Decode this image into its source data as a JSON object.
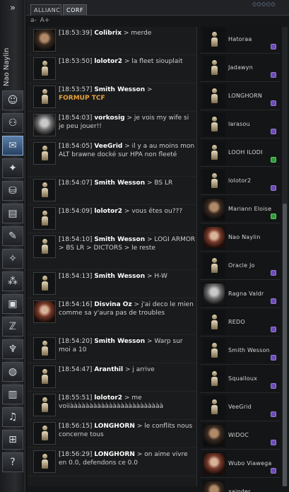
{
  "neocom": {
    "pilot_name": "Nao Naylin",
    "buttons": [
      {
        "icon": "character-icon",
        "glyph": "☺"
      },
      {
        "icon": "people-icon",
        "glyph": "⚇"
      },
      {
        "icon": "mail-icon",
        "glyph": "✉"
      },
      {
        "icon": "map-icon",
        "glyph": "✦"
      },
      {
        "icon": "market-icon",
        "glyph": "⛁"
      },
      {
        "icon": "journal-icon",
        "glyph": "▤"
      },
      {
        "icon": "notepad-icon",
        "glyph": "✎"
      },
      {
        "icon": "starmap-icon",
        "glyph": "✧"
      },
      {
        "icon": "fleet-icon",
        "glyph": "⁂"
      },
      {
        "icon": "cargo-icon",
        "glyph": "▣"
      },
      {
        "icon": "skills-icon",
        "glyph": "ℤ"
      },
      {
        "icon": "corporation-icon",
        "glyph": "♆"
      },
      {
        "icon": "alliance-icon",
        "glyph": "◍"
      },
      {
        "icon": "log-icon",
        "glyph": "▥"
      },
      {
        "icon": "music-icon",
        "glyph": "♫"
      },
      {
        "icon": "calculator-icon",
        "glyph": "⊞"
      },
      {
        "icon": "help-icon",
        "glyph": "?"
      }
    ]
  },
  "tabs": [
    {
      "label": "ALLIANC",
      "active": false
    },
    {
      "label": "CORF",
      "active": true
    }
  ],
  "toolbar": {
    "font_small": "a-",
    "font_large": "A+"
  },
  "messages": [
    {
      "time": "[18:53:39]",
      "author": "Colibrix",
      "text": "merde",
      "portrait": "photo-dark"
    },
    {
      "time": "[18:53:50]",
      "author": "lolotor2",
      "text": "la fleet siouplait",
      "portrait": "silhouette"
    },
    {
      "time": "[18:53:57]",
      "author": "Smith Wesson",
      "text": "",
      "highlight": "FORMUP TCF",
      "portrait": "silhouette"
    },
    {
      "time": "[18:54:03]",
      "author": "vorkosig",
      "text": "je vois my wife si je peu jouer!!",
      "portrait": "photo-grey"
    },
    {
      "time": "[18:54:05]",
      "author": "VeeGrid",
      "text": "il y a au moins mon ALT brawne docké sur HPA non fleeté",
      "portrait": "silhouette",
      "tall": true
    },
    {
      "time": "[18:54:07]",
      "author": "Smith Wesson",
      "text": "BS LR",
      "portrait": "silhouette"
    },
    {
      "time": "[18:54:09]",
      "author": "lolotor2",
      "text": "vous êtes ou???",
      "portrait": "silhouette"
    },
    {
      "time": "[18:54:10]",
      "author": "Smith Wesson",
      "text": "LOGI ARMOR > BS LR > DICTORS > le reste",
      "portrait": "silhouette",
      "tall": true
    },
    {
      "time": "[18:54:13]",
      "author": "Smith Wesson",
      "text": "H-W",
      "portrait": "silhouette"
    },
    {
      "time": "[18:54:16]",
      "author": "Disvina Oz",
      "text": "j'ai deco le mien comme sa y'aura pas de troubles",
      "portrait": "photo-woman",
      "tall": true
    },
    {
      "time": "[18:54:20]",
      "author": "Smith Wesson",
      "text": "Warp sur moi a 10",
      "portrait": "silhouette"
    },
    {
      "time": "[18:54:47]",
      "author": "Aranthil",
      "text": "j arrive",
      "portrait": "silhouette"
    },
    {
      "time": "[18:55:51]",
      "author": "lolotor2",
      "text": "me voiiàààààààààààààààààààààààà",
      "portrait": "silhouette"
    },
    {
      "time": "[18:56:15]",
      "author": "LONGHORN",
      "text": "le conflits nous concerne tous",
      "portrait": "silhouette"
    },
    {
      "time": "[18:56:29]",
      "author": "LONGHORN",
      "text": "on aime vivre en 0.0, defendons ce 0.0",
      "portrait": "silhouette"
    }
  ],
  "members": [
    {
      "name": "Hatoraa",
      "portrait": "silhouette",
      "badge": "purple"
    },
    {
      "name": "Jadawyn",
      "portrait": "silhouette",
      "badge": "purple"
    },
    {
      "name": "LONGHORN",
      "portrait": "silhouette",
      "badge": "purple"
    },
    {
      "name": "larasou",
      "portrait": "silhouette",
      "badge": "purple"
    },
    {
      "name": "LOOH ILODI",
      "portrait": "silhouette",
      "badge": "green"
    },
    {
      "name": "lolotor2",
      "portrait": "silhouette",
      "badge": "purple"
    },
    {
      "name": "Mariann Eloise",
      "portrait": "photo-dark",
      "badge": "green"
    },
    {
      "name": "Nao Naylin",
      "portrait": "photo-woman",
      "badge": ""
    },
    {
      "name": "Oracle Jo",
      "portrait": "silhouette",
      "badge": "purple"
    },
    {
      "name": "Ragna Valdr",
      "portrait": "photo-grey",
      "badge": "purple"
    },
    {
      "name": "REDO",
      "portrait": "silhouette",
      "badge": "purple"
    },
    {
      "name": "Smith Wesson",
      "portrait": "silhouette",
      "badge": "purple"
    },
    {
      "name": "Squalloux",
      "portrait": "silhouette",
      "badge": "purple"
    },
    {
      "name": "VeeGrid",
      "portrait": "silhouette",
      "badge": "purple"
    },
    {
      "name": "WiDOC",
      "portrait": "photo-dark",
      "badge": "purple"
    },
    {
      "name": "Wubo Viawega",
      "portrait": "photo-woman",
      "badge": "purple"
    },
    {
      "name": "xainder",
      "portrait": "photo-dark",
      "badge": "green"
    }
  ]
}
